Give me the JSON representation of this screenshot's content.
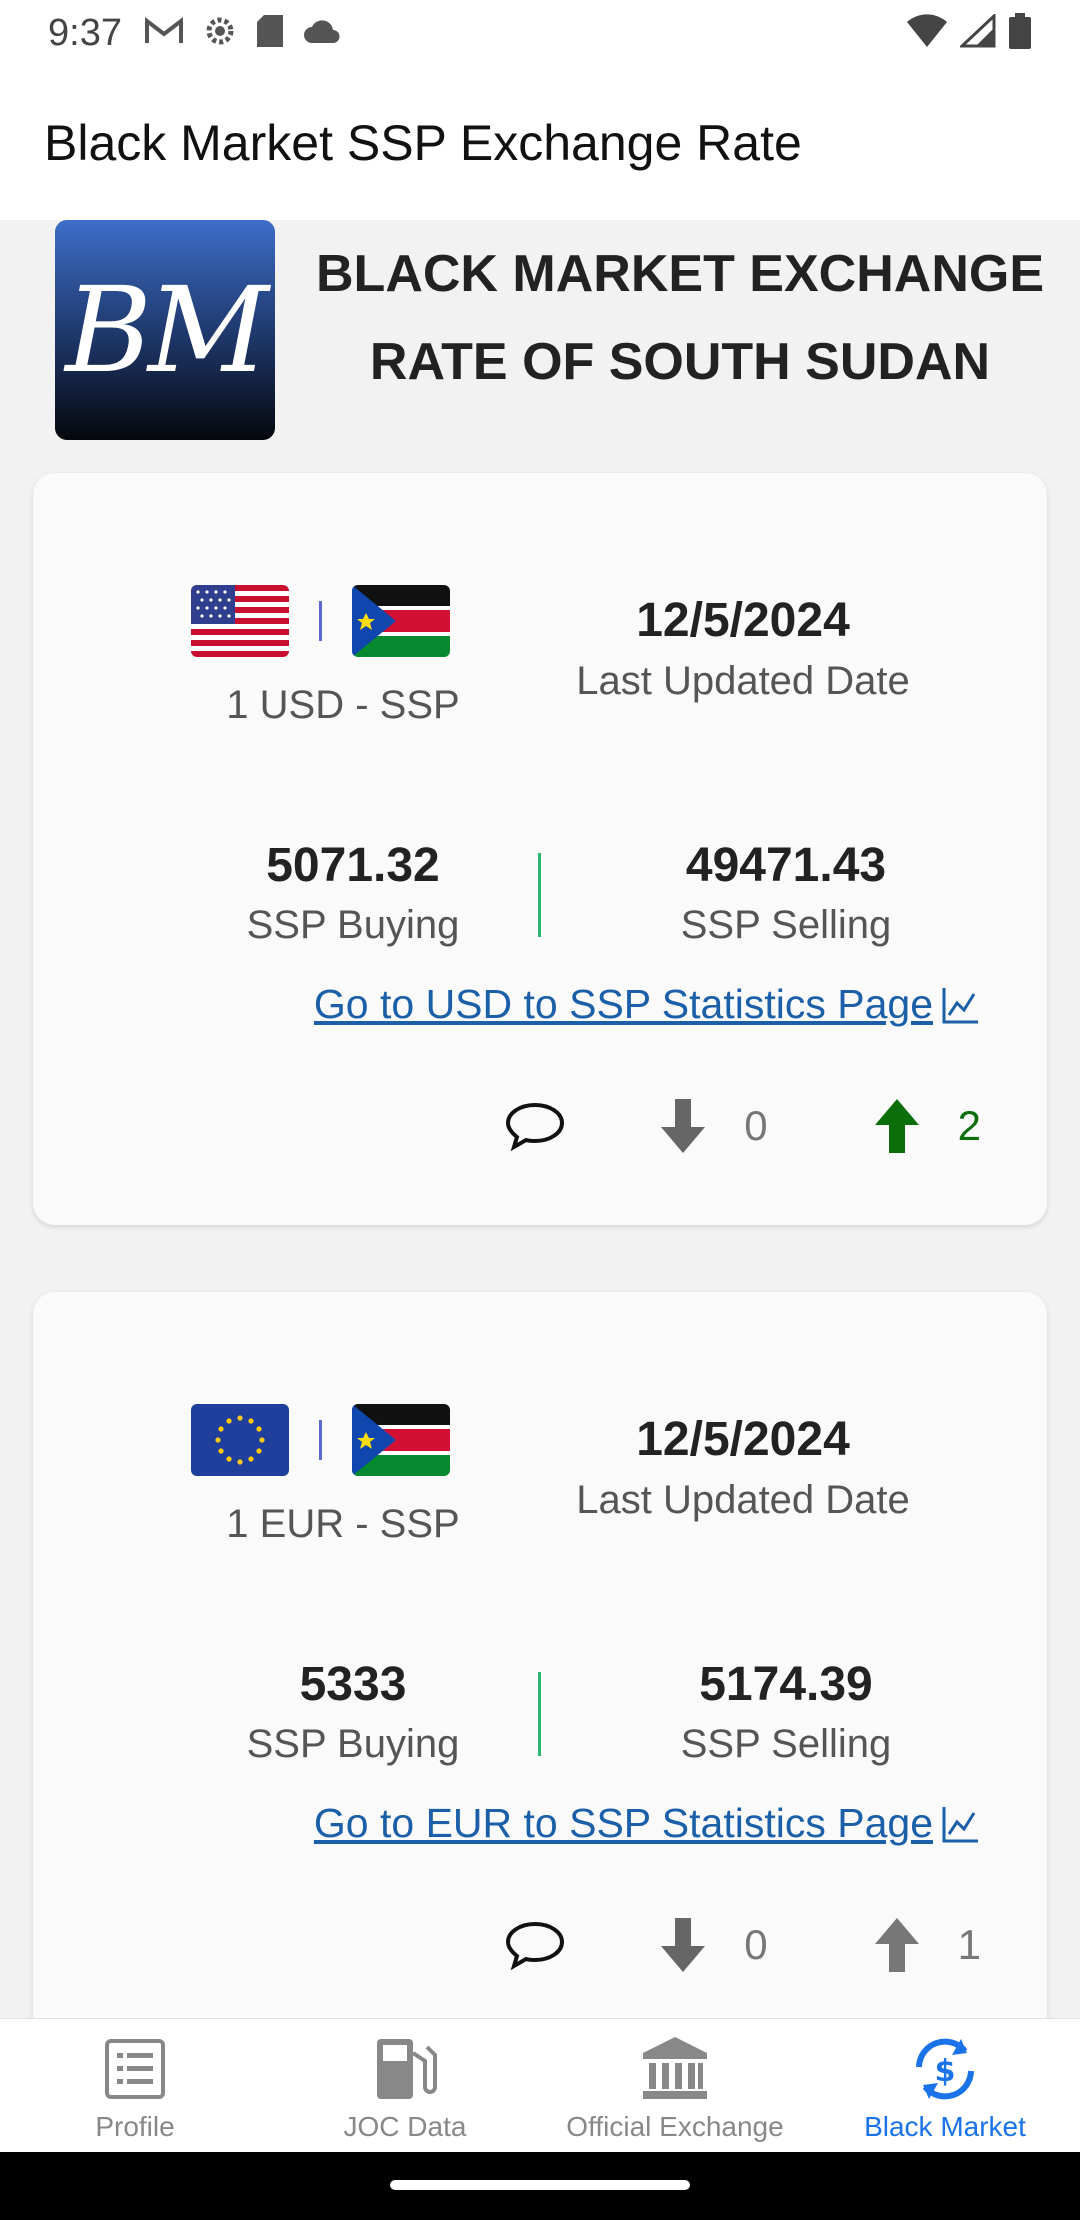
{
  "status_bar": {
    "time": "9:37",
    "icons_left": [
      "gmail-icon",
      "settings-icon",
      "sd-card-icon",
      "cloud-icon"
    ],
    "icons_right": [
      "wifi-icon",
      "signal-icon",
      "battery-icon"
    ]
  },
  "app_bar": {
    "title": "Black Market SSP Exchange Rate"
  },
  "banner": {
    "logo_text": "BM",
    "title_line1": "BLACK MARKET EXCHANGE",
    "title_line2": "RATE OF SOUTH SUDAN"
  },
  "cards": [
    {
      "pair_label": "1 USD - SSP",
      "base_flag": "usa-flag-icon",
      "quote_flag": "south-sudan-flag-icon",
      "date": "12/5/2024",
      "date_label": "Last Updated Date",
      "buying_value": "5071.32",
      "buying_label": "SSP Buying",
      "selling_value": "49471.43",
      "selling_label": "SSP Selling",
      "stats_link": "Go to USD to SSP Statistics Page",
      "downvotes": "0",
      "upvotes": "2"
    },
    {
      "pair_label": "1 EUR - SSP",
      "base_flag": "eu-flag-icon",
      "quote_flag": "south-sudan-flag-icon",
      "date": "12/5/2024",
      "date_label": "Last Updated Date",
      "buying_value": "5333",
      "buying_label": "SSP Buying",
      "selling_value": "5174.39",
      "selling_label": "SSP Selling",
      "stats_link": "Go to EUR to SSP Statistics Page",
      "downvotes": "0",
      "upvotes": "1"
    }
  ],
  "bottom_nav": {
    "items": [
      {
        "label": "Profile",
        "icon": "list-icon"
      },
      {
        "label": "JOC Data",
        "icon": "fuel-pump-icon"
      },
      {
        "label": "Official Exchange",
        "icon": "bank-icon"
      },
      {
        "label": "Black Market",
        "icon": "currency-exchange-icon"
      }
    ],
    "active": "Black Market"
  },
  "colors": {
    "accent": "#1a73e8",
    "link": "#1a5fa8",
    "divider_green": "#2bb673",
    "upvote_active": "#0b6e0b"
  }
}
